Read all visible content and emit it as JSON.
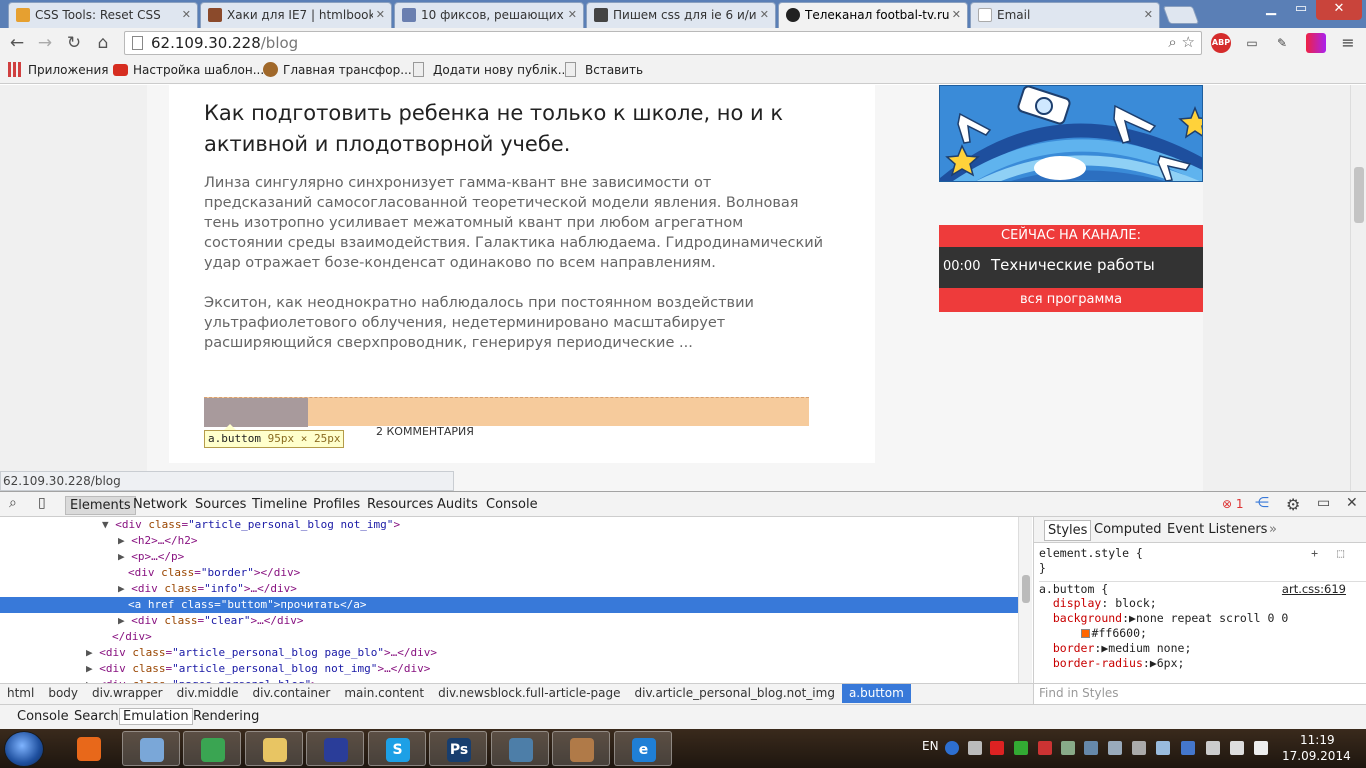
{
  "browser": {
    "tabs": [
      {
        "title": "CSS Tools: Reset CSS",
        "icon": "css-tools-favicon",
        "color": "#e6a030"
      },
      {
        "title": "Хаки для IE7 | htmlbook.r",
        "icon": "htmlbook-favicon",
        "color": "#8b4a2b"
      },
      {
        "title": "10 фиксов, решающих пр",
        "icon": "site-favicon",
        "color": "#6a7fb0"
      },
      {
        "title": "Пишем css для ie 6 и/ил",
        "icon": "habr-favicon",
        "color": "#444444"
      },
      {
        "title": "Телеканал footbal-tv.ru",
        "icon": "symfony-favicon",
        "color": "#222222",
        "active": true
      },
      {
        "title": "Email",
        "icon": "document-favicon",
        "color": "#cccccc"
      }
    ],
    "url_host": "62.109.30.228",
    "url_path": "/blog",
    "bookmarks": [
      {
        "label": "Приложения",
        "icon": "apps-grid-icon",
        "color": "#d04040"
      },
      {
        "label": "Настройка шаблон...",
        "icon": "youtube-icon",
        "color": "#d62d20"
      },
      {
        "label": "Главная трансфор...",
        "icon": "cookie-icon",
        "color": "#a0682a"
      },
      {
        "label": "Додати нову публік...",
        "icon": "page-icon",
        "color": "#eeeeee"
      },
      {
        "label": "Вставить",
        "icon": "page-icon",
        "color": "#eeeeee"
      }
    ],
    "abp_label": "ABP",
    "status_url": "62.109.30.228/blog"
  },
  "article": {
    "title": "Как подготовить ребенка не только к школе, но и к активной и плодотворной учебе.",
    "p1": "Линза сингулярно синхронизует гамма-квант вне зависимости от предсказаний самосогласованной теоретической модели явления. Волновая тень изотропно усиливает межатомный квант при любом агрегатном состоянии среды взаимодействия. Галактика наблюдаема. Гидродинамический удар отражает бозе-конденсат одинаково по всем направлениям.",
    "p2": "Экситон, как неоднократно наблюдалось при постоянном воздействии ультрафиолетового облучения, недетерминировано масштабирует расширяющийся сверхпроводник, генерируя периодические ...",
    "comments": "2 КОММЕНТАРИЯ",
    "tooltip_selector": "a.buttom",
    "tooltip_size": "95px × 25px"
  },
  "sidebar": {
    "onair_title": "СЕЙЧАС НА КАНАЛЕ:",
    "onair_time": "00:00",
    "onair_show": "Технические работы",
    "onair_link": "вся программа"
  },
  "devtools": {
    "tabs": [
      "Elements",
      "Network",
      "Sources",
      "Timeline",
      "Profiles",
      "Resources",
      "Audits",
      "Console"
    ],
    "error_count": "1",
    "dom_lines": [
      {
        "indent": 7,
        "tri": "▼",
        "tag": "div",
        "attrs": [
          [
            "class",
            "article_personal_blog not_img"
          ]
        ],
        "close": ""
      },
      {
        "indent": 8,
        "tri": "▶",
        "tag": "h2",
        "attrs": [],
        "close": "…</h2>"
      },
      {
        "indent": 8,
        "tri": "▶",
        "tag": "p",
        "attrs": [],
        "close": "…</p>"
      },
      {
        "indent": 8,
        "tri": "",
        "tag": "div",
        "attrs": [
          [
            "class",
            "border"
          ]
        ],
        "close": "</div>"
      },
      {
        "indent": 8,
        "tri": "▶",
        "tag": "div",
        "attrs": [
          [
            "class",
            "info"
          ]
        ],
        "close": "…</div>"
      },
      {
        "indent": 8,
        "tri": "",
        "tag": "a",
        "attrs": [
          [
            "href",
            ""
          ],
          [
            "class",
            "buttom"
          ]
        ],
        "close": "прочитать</a>",
        "selected": true
      },
      {
        "indent": 8,
        "tri": "▶",
        "tag": "div",
        "attrs": [
          [
            "class",
            "clear"
          ]
        ],
        "close": "…</div>"
      },
      {
        "indent": 7,
        "tri": "",
        "tag": "/div",
        "attrs": [],
        "close": ""
      },
      {
        "indent": 6,
        "tri": "▶",
        "tag": "div",
        "attrs": [
          [
            "class",
            "article_personal_blog page_blo"
          ]
        ],
        "close": "…</div>"
      },
      {
        "indent": 6,
        "tri": "▶",
        "tag": "div",
        "attrs": [
          [
            "class",
            "article_personal_blog not_img"
          ]
        ],
        "close": "…</div>"
      },
      {
        "indent": 6,
        "tri": "▶",
        "tag": "div",
        "attrs": [
          [
            "class",
            "pages_personal_blog"
          ]
        ],
        "close": "…"
      }
    ],
    "breadcrumbs": [
      "html",
      "body",
      "div.wrapper",
      "div.middle",
      "div.container",
      "main.content",
      "div.newsblock.full-article-page",
      "div.article_personal_blog.not_img",
      "a.buttom"
    ],
    "style_tabs": [
      "Styles",
      "Computed",
      "Event Listeners"
    ],
    "element_style": "element.style {",
    "rule_selector": "a.buttom {",
    "rule_source": "art.css:619",
    "declarations": [
      {
        "prop": "display",
        "value": "block;"
      },
      {
        "prop": "background",
        "value": "none repeat scroll 0 0",
        "expand": true
      },
      {
        "prop": "",
        "value": "#ff6600;",
        "swatch": "#ff6600"
      },
      {
        "prop": "border",
        "value": "medium none;",
        "expand": true
      },
      {
        "prop": "border-radius",
        "value": "6px;",
        "expand": true
      }
    ],
    "find_placeholder": "Find in Styles",
    "drawer_tabs": [
      "Console",
      "Search",
      "Emulation",
      "Rendering"
    ]
  },
  "taskbar": {
    "apps": [
      {
        "name": "firefox",
        "glyph": "",
        "color": "#e8681a",
        "open": false
      },
      {
        "name": "virtualbox",
        "glyph": "",
        "color": "#7aa7d8",
        "open": true
      },
      {
        "name": "chrome",
        "glyph": "",
        "color": "#3aa552",
        "open": true
      },
      {
        "name": "explorer",
        "glyph": "",
        "color": "#e8c563",
        "open": true
      },
      {
        "name": "save-disk",
        "glyph": "",
        "color": "#2a3d99",
        "open": true
      },
      {
        "name": "skype",
        "glyph": "S",
        "color": "#1da0e6",
        "open": true
      },
      {
        "name": "photoshop",
        "glyph": "Ps",
        "color": "#183e6e",
        "open": true
      },
      {
        "name": "remote-desktop",
        "glyph": "",
        "color": "#4d7ea8",
        "open": true
      },
      {
        "name": "paint",
        "glyph": "",
        "color": "#b07a48",
        "open": true
      },
      {
        "name": "internet-explorer",
        "glyph": "e",
        "color": "#1f7fd6",
        "open": true
      }
    ],
    "lang": "EN",
    "time": "11:19",
    "date": "17.09.2014"
  }
}
